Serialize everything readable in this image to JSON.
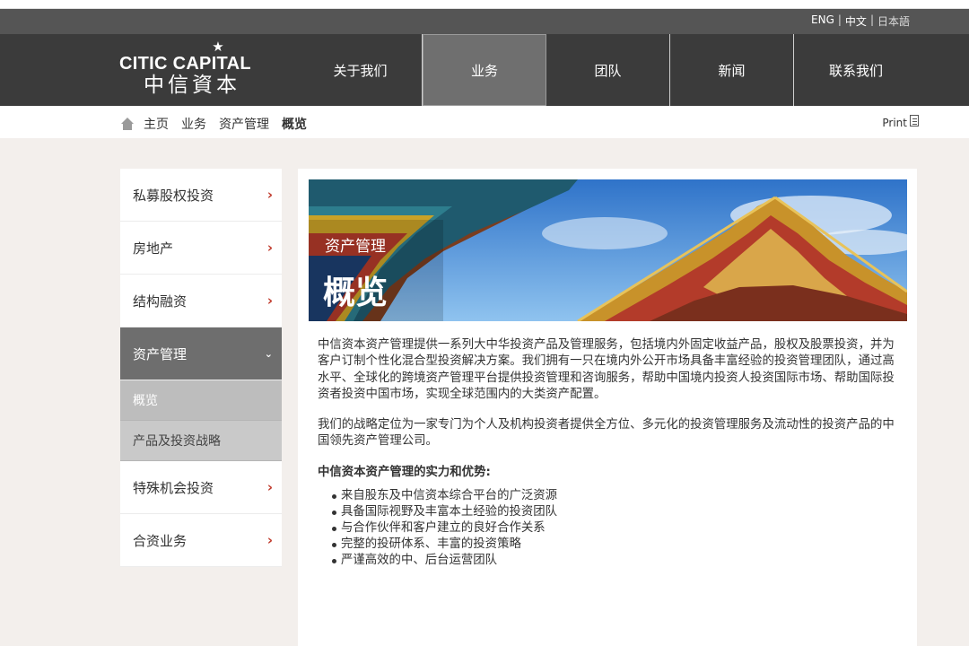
{
  "lang": {
    "en": "ENG",
    "zh": "中文",
    "ja": "日本語",
    "sep": "|"
  },
  "logo": {
    "star": "★",
    "en": "CITIC CAPITAL",
    "zh": "中信資本"
  },
  "nav": [
    {
      "label": "关于我们"
    },
    {
      "label": "业务"
    },
    {
      "label": "团队"
    },
    {
      "label": "新闻"
    },
    {
      "label": "联系我们"
    }
  ],
  "breadcrumb": {
    "home": "主页",
    "l1": "业务",
    "l2": "资产管理",
    "current": "概览"
  },
  "print": "Print",
  "sidebar": {
    "items": [
      {
        "label": "私募股权投资",
        "chevron": "›"
      },
      {
        "label": "房地产",
        "chevron": "›"
      },
      {
        "label": "结构融资",
        "chevron": "›"
      },
      {
        "label": "资产管理",
        "chevron": "⌄"
      },
      {
        "label": "特殊机会投资",
        "chevron": "›"
      },
      {
        "label": "合资业务",
        "chevron": "›"
      }
    ],
    "sub": [
      {
        "label": "概览"
      },
      {
        "label": "产品及投资战略"
      }
    ]
  },
  "banner": {
    "sub": "资产管理",
    "title": "概览"
  },
  "content": {
    "p1": "中信资本资产管理提供一系列大中华投资产品及管理服务，包括境内外固定收益产品，股权及股票投资，并为客户订制个性化混合型投资解决方案。我们拥有一只在境内外公开市场具备丰富经验的投资管理团队，通过高水平、全球化的跨境资产管理平台提供投资管理和咨询服务，帮助中国境内投资人投资国际市场、帮助国际投资者投资中国市场，实现全球范围内的大类资产配置。",
    "p2": "我们的战略定位为一家专门为个人及机构投资者提供全方位、多元化的投资管理服务及流动性的投资产品的中国领先资产管理公司。",
    "heading": "中信资本资产管理的实力和优势:",
    "bullets": [
      "来自股东及中信资本综合平台的广泛资源",
      "具备国际视野及丰富本土经验的投资团队",
      "与合作伙伴和客户建立的良好合作关系",
      "完整的投研体系、丰富的投资策略",
      "严谨高效的中、后台运营团队"
    ]
  }
}
